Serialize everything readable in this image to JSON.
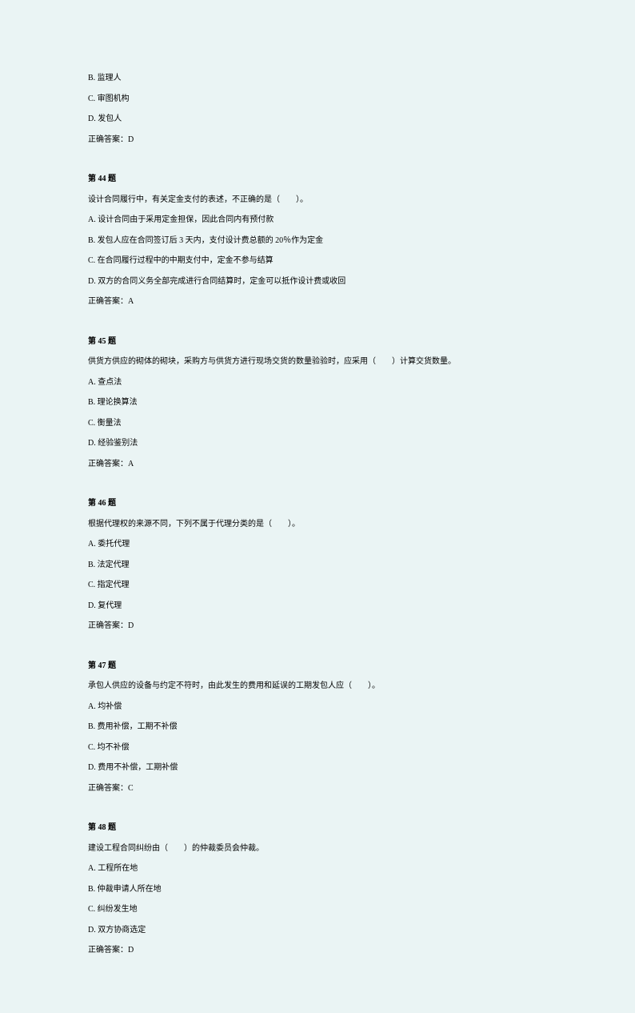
{
  "preOptions": [
    "B. 监理人",
    "C. 审图机构",
    "D. 发包人"
  ],
  "preAnswerLabel": "正确答案：D",
  "questions": [
    {
      "title": "第 44 题",
      "stem": "设计合同履行中，有关定金支付的表述，不正确的是（　　）。",
      "options": [
        "A. 设计合同由于采用定金担保，因此合同内有预付款",
        "B. 发包人应在合同签订后 3 天内，支付设计费总额的 20％作为定金",
        "C. 在合同履行过程中的中期支付中，定金不参与结算",
        "D. 双方的合同义务全部完成进行合同结算时，定金可以抵作设计费或收回"
      ],
      "answer": "正确答案：A"
    },
    {
      "title": "第 45 题",
      "stem": "供货方供应的砌体的砌块，采购方与供货方进行现场交货的数量验验时，应采用（　　）计算交货数量。",
      "options": [
        "A. 查点法",
        "B. 理论换算法",
        "C. 衡量法",
        "D. 经验鉴别法"
      ],
      "answer": "正确答案：A"
    },
    {
      "title": "第 46 题",
      "stem": "根据代理权的来源不同，下列不属于代理分类的是（　　）。",
      "options": [
        "A. 委托代理",
        "B. 法定代理",
        "C. 指定代理",
        "D. 复代理"
      ],
      "answer": "正确答案：D"
    },
    {
      "title": "第 47 题",
      "stem": "承包人供应的设备与约定不符时，由此发生的费用和延误的工期发包人应（　　）。",
      "options": [
        "A. 均补偿",
        "B. 费用补偿，工期不补偿",
        "C. 均不补偿",
        "D. 费用不补偿，工期补偿"
      ],
      "answer": "正确答案：C"
    },
    {
      "title": "第 48 题",
      "stem": "建设工程合同纠纷由（　　）的仲裁委员会仲裁。",
      "options": [
        "A. 工程所在地",
        "B. 仲裁申请人所在地",
        "C. 纠纷发生地",
        "D. 双方协商选定"
      ],
      "answer": "正确答案：D"
    }
  ]
}
